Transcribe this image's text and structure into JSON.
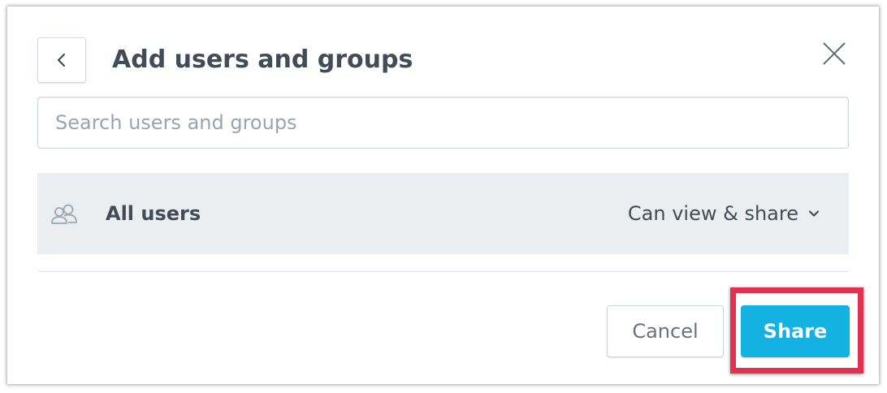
{
  "dialog": {
    "title": "Add users and groups",
    "back_icon": "chevron-left-icon",
    "close_icon": "close-icon"
  },
  "search": {
    "placeholder": "Search users and groups",
    "value": ""
  },
  "shared_with": [
    {
      "icon": "users-icon",
      "name": "All users",
      "permission": "Can view & share",
      "dropdown_icon": "chevron-down-icon"
    }
  ],
  "footer": {
    "cancel_label": "Cancel",
    "share_label": "Share"
  },
  "colors": {
    "primary": "#14b2e2",
    "highlight": "#e23150",
    "row_background": "#ebeef1",
    "text": "#424c56"
  }
}
